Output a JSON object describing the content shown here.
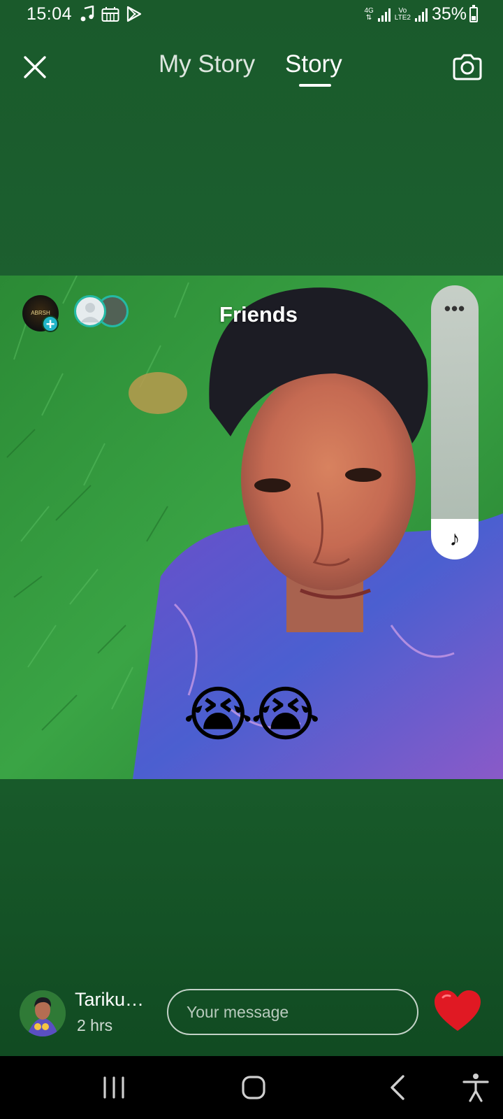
{
  "status_bar": {
    "time": "15:04",
    "left_icons": [
      "music-note-icon",
      "piano-icon",
      "play-store-icon"
    ],
    "network_1": "4G",
    "network_2_top": "Vo",
    "network_2_bottom": "LTE2",
    "battery": "35%",
    "battery_level": 0.35
  },
  "header": {
    "tabs": [
      {
        "label": "My Story",
        "active": false
      },
      {
        "label": "Story",
        "active": true
      }
    ]
  },
  "story": {
    "audience": "Friends",
    "my_avatar_text": "ABRSH",
    "emoji": "😭😭"
  },
  "footer": {
    "poster_name": "Tariku…",
    "posted_time": "2 hrs",
    "message_placeholder": "Your message"
  },
  "colors": {
    "background": "#1d6332",
    "accent_teal": "#22b6c9",
    "heart": "#e01923"
  }
}
